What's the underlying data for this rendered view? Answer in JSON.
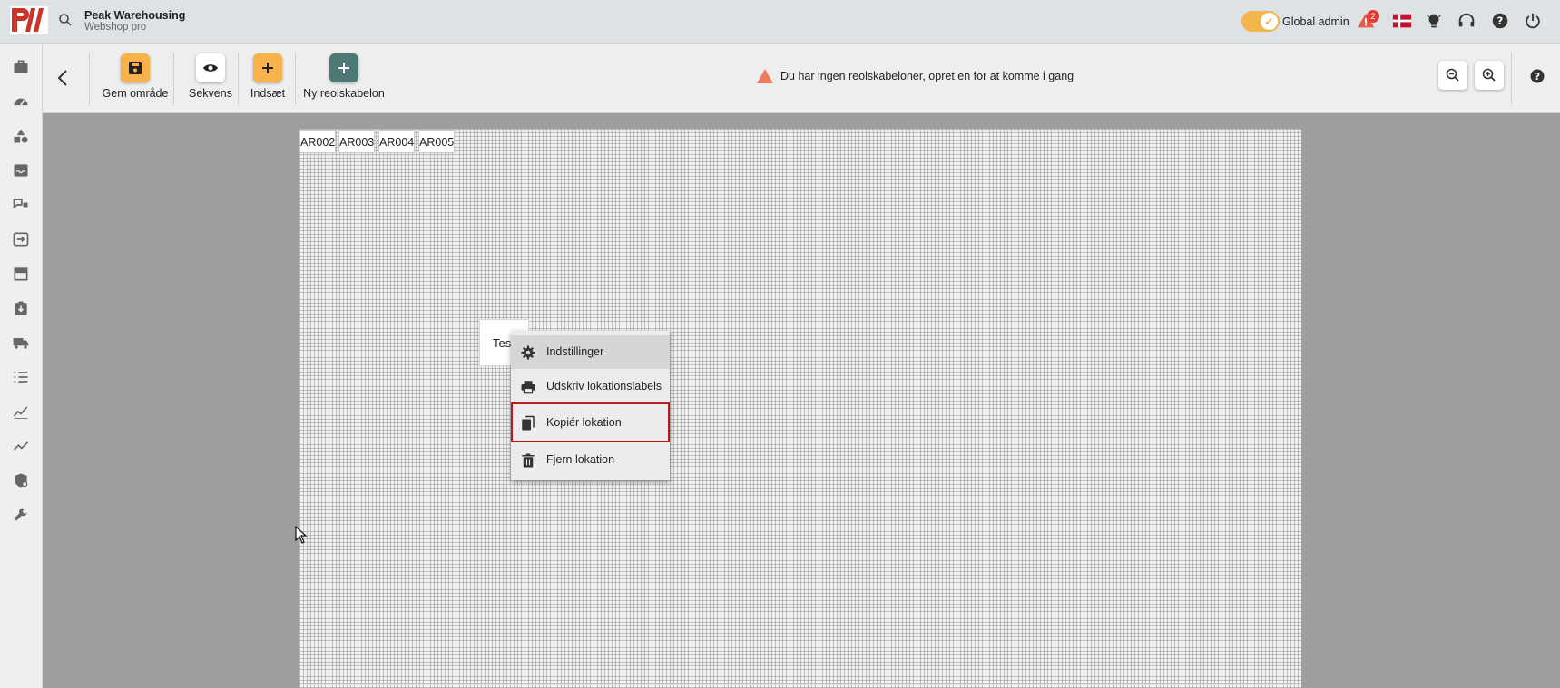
{
  "app": {
    "company": "Peak Warehousing",
    "subtitle": "Webshop pro",
    "role_label": "Global admin",
    "notification_count": "2",
    "toggle_on": true
  },
  "toolbar": {
    "save_label": "Gem område",
    "sequence_label": "Sekvens",
    "insert_label": "Indsæt",
    "new_rack_label": "Ny reolskabelon",
    "warning_text": "Du har ingen reolskabeloner, opret en for at komme i gang"
  },
  "canvas": {
    "locations": [
      "AR002",
      "AR003",
      "AR004",
      "AR005"
    ],
    "test_location_label": "Tes"
  },
  "context_menu": {
    "items": [
      {
        "label": "Indstillinger",
        "icon": "gear-icon"
      },
      {
        "label": "Udskriv lokationslabels",
        "icon": "printer-icon"
      },
      {
        "label": "Kopiér lokation",
        "icon": "copy-icon"
      },
      {
        "label": "Fjern lokation",
        "icon": "trash-icon"
      }
    ]
  },
  "colors": {
    "accent_orange": "#f7b24b",
    "teal": "#4d7873",
    "warning": "#f07b5c",
    "selected_outline": "#b71c1c"
  }
}
